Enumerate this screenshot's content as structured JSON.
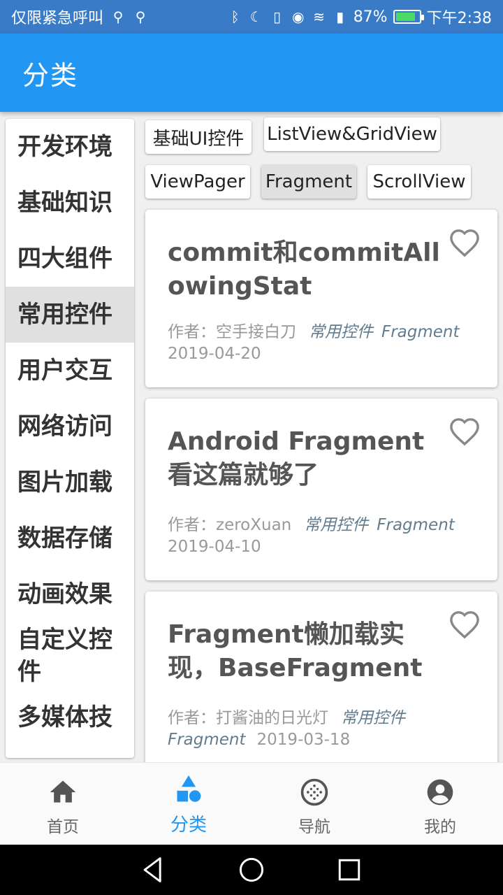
{
  "statusbar": {
    "carrier": "仅限紧急呼叫",
    "battery_percent": "87%",
    "battery_level": 0.87,
    "time": "下午2:38"
  },
  "appbar": {
    "title": "分类"
  },
  "categories": [
    {
      "label": "开发环境",
      "active": false
    },
    {
      "label": "基础知识",
      "active": false
    },
    {
      "label": "四大组件",
      "active": false
    },
    {
      "label": "常用控件",
      "active": true
    },
    {
      "label": "用户交互",
      "active": false
    },
    {
      "label": "网络访问",
      "active": false
    },
    {
      "label": "图片加载",
      "active": false
    },
    {
      "label": "数据存储",
      "active": false
    },
    {
      "label": "动画效果",
      "active": false
    },
    {
      "label": "自定义控件",
      "active": false
    },
    {
      "label": "多媒体技",
      "active": false
    }
  ],
  "chips": [
    {
      "label": "基础UI控件",
      "active": false
    },
    {
      "label": "ListView&GridView",
      "active": false
    },
    {
      "label": "ViewPager",
      "active": false
    },
    {
      "label": "Fragment",
      "active": true
    },
    {
      "label": "ScrollView",
      "active": false
    }
  ],
  "articles": [
    {
      "title": "commit和commitAllowingStat",
      "author": "作者：空手接白刀",
      "tags": [
        "常用控件",
        "Fragment"
      ],
      "date": "2019-04-20",
      "favorite": false
    },
    {
      "title": "Android Fragment看这篇就够了",
      "author": "作者：zeroXuan",
      "tags": [
        "常用控件",
        "Fragment"
      ],
      "date": "2019-04-10",
      "favorite": false
    },
    {
      "title": "Fragment懒加载实现，BaseFragment",
      "author": "作者：打酱油的日光灯",
      "tags": [
        "常用控件",
        "Fragment"
      ],
      "date": "2019-03-18",
      "favorite": false
    }
  ],
  "bottomnav": [
    {
      "label": "首页",
      "icon": "home-icon",
      "active": false
    },
    {
      "label": "分类",
      "icon": "shapes-icon",
      "active": true
    },
    {
      "label": "导航",
      "icon": "compass-icon",
      "active": false
    },
    {
      "label": "我的",
      "icon": "account-icon",
      "active": false
    }
  ],
  "colors": {
    "status_bar": "#3a7bc8",
    "app_bar": "#2196f3",
    "accent": "#2196f3",
    "tag_text": "#627c8f"
  }
}
